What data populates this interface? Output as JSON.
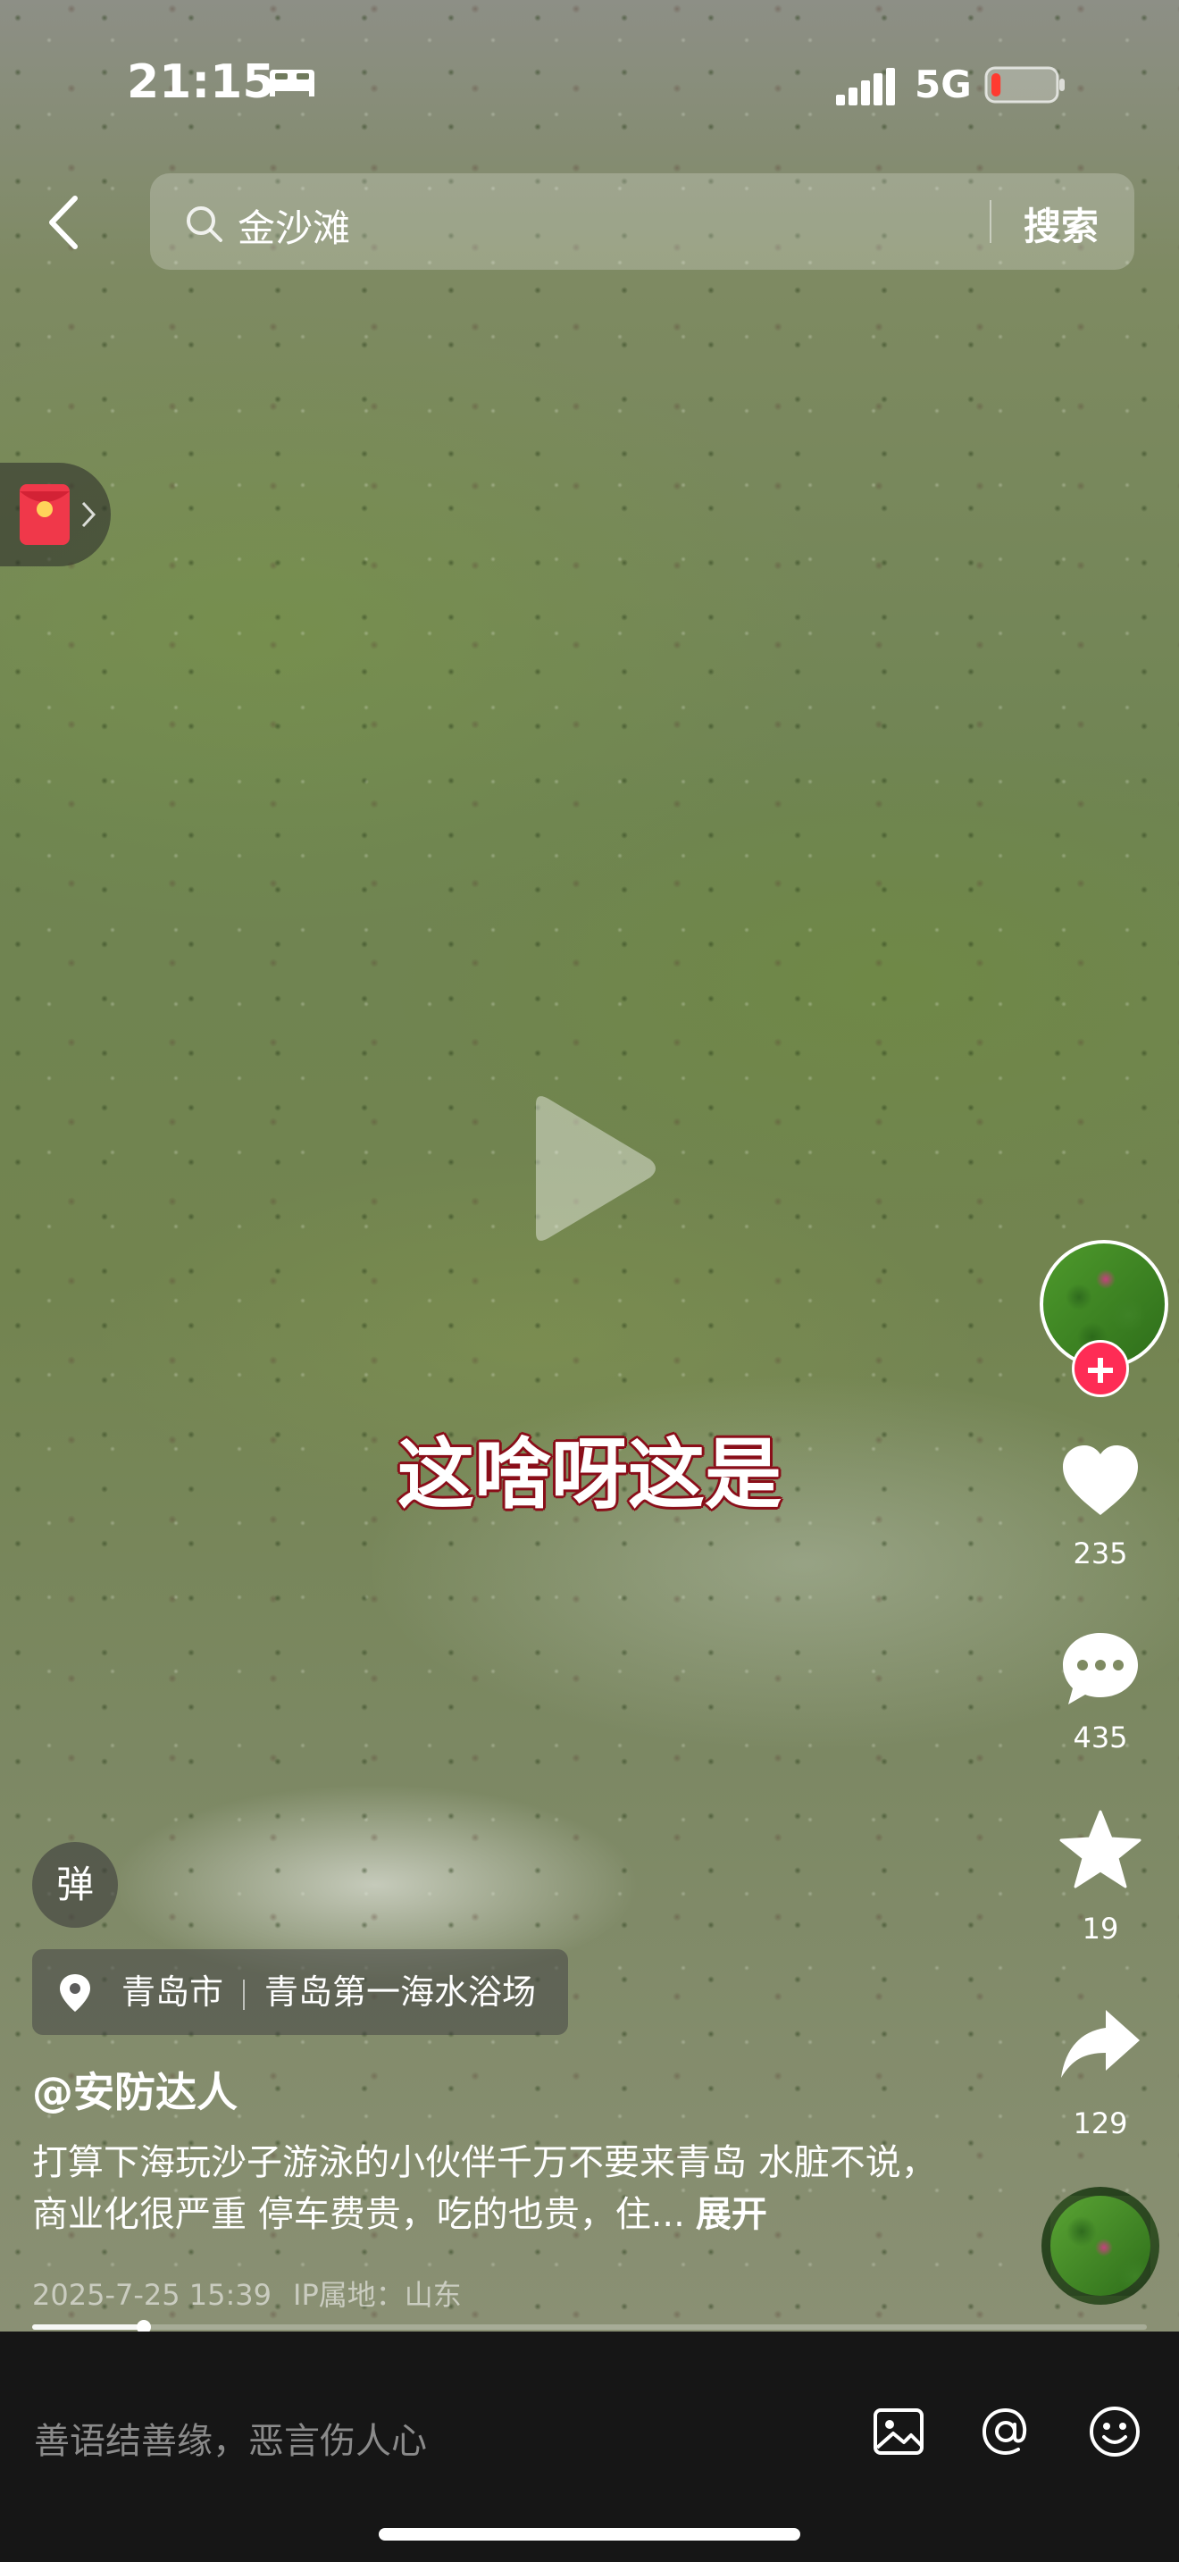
{
  "status_bar": {
    "time": "21:15",
    "network": "5G",
    "bed_icon": "bed-icon",
    "signal_icon": "signal-icon",
    "battery_icon": "battery-low-icon",
    "battery_level": 0.15
  },
  "search": {
    "query": "金沙滩",
    "button_label": "搜索"
  },
  "video": {
    "caption": "这啥呀这是",
    "progress": 0.1
  },
  "actions": {
    "likes": "235",
    "comments": "435",
    "favorites": "19",
    "shares": "129"
  },
  "post": {
    "danmu_label": "弹",
    "location_city": "青岛市",
    "location_place": "青岛第一海水浴场",
    "author": "@安防达人",
    "description": "打算下海玩沙子游泳的小伙伴千万不要来青岛 水脏不说，商业化很严重 停车费贵，吃的也贵，住...",
    "expand_label": "展开",
    "datetime": "2025-7-25 15:39",
    "ip_location": "IP属地：山东"
  },
  "comment_bar": {
    "placeholder": "善语结善缘，恶言伤人心"
  },
  "colors": {
    "accent_red": "#fe2c55",
    "caption_outline": "#8a0f1a",
    "comment_bar_bg": "#161616"
  }
}
